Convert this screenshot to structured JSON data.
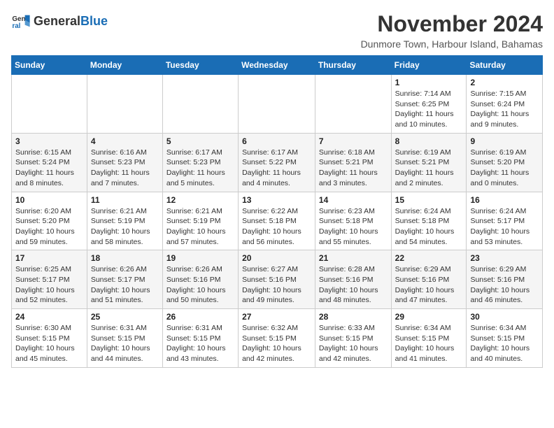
{
  "logo": {
    "text_general": "General",
    "text_blue": "Blue"
  },
  "title": "November 2024",
  "subtitle": "Dunmore Town, Harbour Island, Bahamas",
  "weekdays": [
    "Sunday",
    "Monday",
    "Tuesday",
    "Wednesday",
    "Thursday",
    "Friday",
    "Saturday"
  ],
  "weeks": [
    [
      {
        "day": "",
        "info": ""
      },
      {
        "day": "",
        "info": ""
      },
      {
        "day": "",
        "info": ""
      },
      {
        "day": "",
        "info": ""
      },
      {
        "day": "",
        "info": ""
      },
      {
        "day": "1",
        "info": "Sunrise: 7:14 AM\nSunset: 6:25 PM\nDaylight: 11 hours and 10 minutes."
      },
      {
        "day": "2",
        "info": "Sunrise: 7:15 AM\nSunset: 6:24 PM\nDaylight: 11 hours and 9 minutes."
      }
    ],
    [
      {
        "day": "3",
        "info": "Sunrise: 6:15 AM\nSunset: 5:24 PM\nDaylight: 11 hours and 8 minutes."
      },
      {
        "day": "4",
        "info": "Sunrise: 6:16 AM\nSunset: 5:23 PM\nDaylight: 11 hours and 7 minutes."
      },
      {
        "day": "5",
        "info": "Sunrise: 6:17 AM\nSunset: 5:23 PM\nDaylight: 11 hours and 5 minutes."
      },
      {
        "day": "6",
        "info": "Sunrise: 6:17 AM\nSunset: 5:22 PM\nDaylight: 11 hours and 4 minutes."
      },
      {
        "day": "7",
        "info": "Sunrise: 6:18 AM\nSunset: 5:21 PM\nDaylight: 11 hours and 3 minutes."
      },
      {
        "day": "8",
        "info": "Sunrise: 6:19 AM\nSunset: 5:21 PM\nDaylight: 11 hours and 2 minutes."
      },
      {
        "day": "9",
        "info": "Sunrise: 6:19 AM\nSunset: 5:20 PM\nDaylight: 11 hours and 0 minutes."
      }
    ],
    [
      {
        "day": "10",
        "info": "Sunrise: 6:20 AM\nSunset: 5:20 PM\nDaylight: 10 hours and 59 minutes."
      },
      {
        "day": "11",
        "info": "Sunrise: 6:21 AM\nSunset: 5:19 PM\nDaylight: 10 hours and 58 minutes."
      },
      {
        "day": "12",
        "info": "Sunrise: 6:21 AM\nSunset: 5:19 PM\nDaylight: 10 hours and 57 minutes."
      },
      {
        "day": "13",
        "info": "Sunrise: 6:22 AM\nSunset: 5:18 PM\nDaylight: 10 hours and 56 minutes."
      },
      {
        "day": "14",
        "info": "Sunrise: 6:23 AM\nSunset: 5:18 PM\nDaylight: 10 hours and 55 minutes."
      },
      {
        "day": "15",
        "info": "Sunrise: 6:24 AM\nSunset: 5:18 PM\nDaylight: 10 hours and 54 minutes."
      },
      {
        "day": "16",
        "info": "Sunrise: 6:24 AM\nSunset: 5:17 PM\nDaylight: 10 hours and 53 minutes."
      }
    ],
    [
      {
        "day": "17",
        "info": "Sunrise: 6:25 AM\nSunset: 5:17 PM\nDaylight: 10 hours and 52 minutes."
      },
      {
        "day": "18",
        "info": "Sunrise: 6:26 AM\nSunset: 5:17 PM\nDaylight: 10 hours and 51 minutes."
      },
      {
        "day": "19",
        "info": "Sunrise: 6:26 AM\nSunset: 5:16 PM\nDaylight: 10 hours and 50 minutes."
      },
      {
        "day": "20",
        "info": "Sunrise: 6:27 AM\nSunset: 5:16 PM\nDaylight: 10 hours and 49 minutes."
      },
      {
        "day": "21",
        "info": "Sunrise: 6:28 AM\nSunset: 5:16 PM\nDaylight: 10 hours and 48 minutes."
      },
      {
        "day": "22",
        "info": "Sunrise: 6:29 AM\nSunset: 5:16 PM\nDaylight: 10 hours and 47 minutes."
      },
      {
        "day": "23",
        "info": "Sunrise: 6:29 AM\nSunset: 5:16 PM\nDaylight: 10 hours and 46 minutes."
      }
    ],
    [
      {
        "day": "24",
        "info": "Sunrise: 6:30 AM\nSunset: 5:15 PM\nDaylight: 10 hours and 45 minutes."
      },
      {
        "day": "25",
        "info": "Sunrise: 6:31 AM\nSunset: 5:15 PM\nDaylight: 10 hours and 44 minutes."
      },
      {
        "day": "26",
        "info": "Sunrise: 6:31 AM\nSunset: 5:15 PM\nDaylight: 10 hours and 43 minutes."
      },
      {
        "day": "27",
        "info": "Sunrise: 6:32 AM\nSunset: 5:15 PM\nDaylight: 10 hours and 42 minutes."
      },
      {
        "day": "28",
        "info": "Sunrise: 6:33 AM\nSunset: 5:15 PM\nDaylight: 10 hours and 42 minutes."
      },
      {
        "day": "29",
        "info": "Sunrise: 6:34 AM\nSunset: 5:15 PM\nDaylight: 10 hours and 41 minutes."
      },
      {
        "day": "30",
        "info": "Sunrise: 6:34 AM\nSunset: 5:15 PM\nDaylight: 10 hours and 40 minutes."
      }
    ]
  ]
}
